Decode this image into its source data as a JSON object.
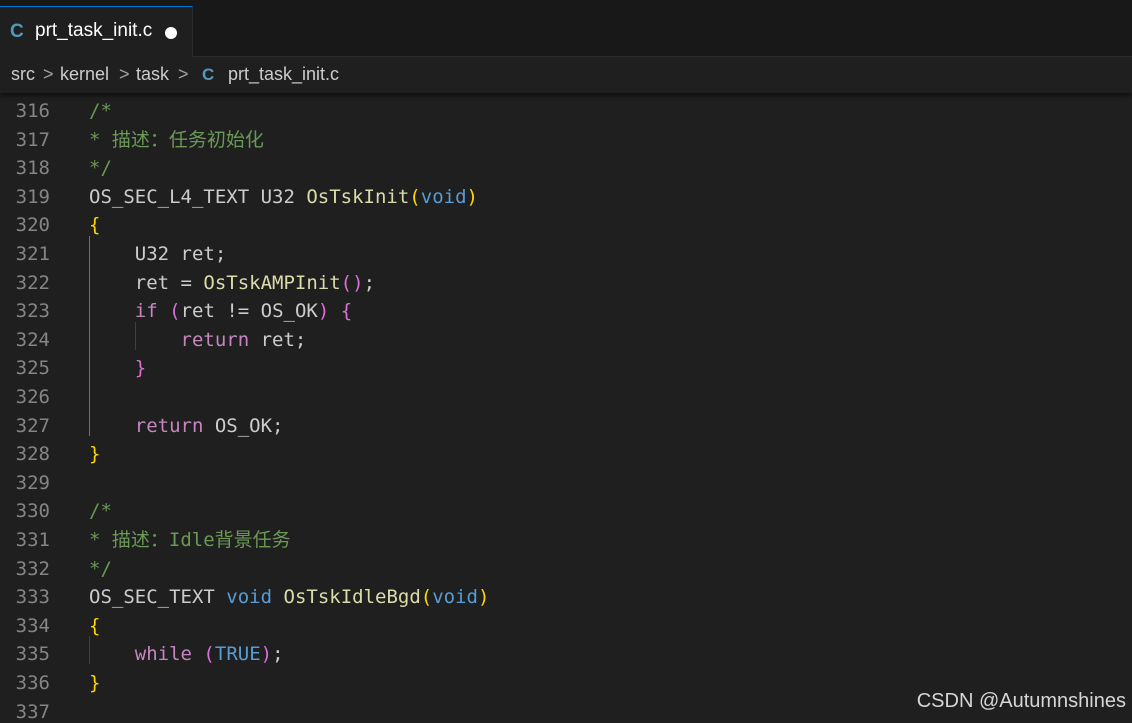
{
  "tab": {
    "file_name": "prt_task_init.c",
    "lang_icon": "C",
    "unsaved_marker": "●"
  },
  "breadcrumb": {
    "items": [
      "src",
      "kernel",
      "task",
      "prt_task_init.c"
    ],
    "separator": ">",
    "file_icon": "C"
  },
  "colors": {
    "keyword_control": "#c586c0",
    "keyword_type": "#569cd6",
    "function": "#dcdcaa",
    "comment": "#6a9955",
    "text": "#cccccc",
    "bracket_level1": "#ffd700",
    "bracket_level2": "#da70d6",
    "bracket_level3": "#179fff",
    "line_number": "#858585",
    "c_icon": "#519aba",
    "tab_active_border": "#0078d4"
  },
  "editor": {
    "lines": [
      {
        "n": "316",
        "tokens": [
          {
            "t": "/*",
            "c": "#6a9955"
          }
        ]
      },
      {
        "n": "317",
        "tokens": [
          {
            "t": "* 描述：任务初始化",
            "c": "#6a9955"
          }
        ]
      },
      {
        "n": "318",
        "tokens": [
          {
            "t": "*/",
            "c": "#6a9955"
          }
        ]
      },
      {
        "n": "319",
        "tokens": [
          {
            "t": "OS_SEC_L4_TEXT U32 ",
            "c": "#cccccc"
          },
          {
            "t": "OsTskInit",
            "c": "#dcdcaa"
          },
          {
            "t": "(",
            "c": "#ffd700"
          },
          {
            "t": "void",
            "c": "#569cd6"
          },
          {
            "t": ")",
            "c": "#ffd700"
          }
        ]
      },
      {
        "n": "320",
        "tokens": [
          {
            "t": "{",
            "c": "#ffd700"
          }
        ]
      },
      {
        "n": "321",
        "tokens": [
          {
            "t": "    U32 ret;",
            "c": "#cccccc"
          }
        ]
      },
      {
        "n": "322",
        "tokens": [
          {
            "t": "    ret = ",
            "c": "#cccccc"
          },
          {
            "t": "OsTskAMPInit",
            "c": "#dcdcaa"
          },
          {
            "t": "()",
            "c": "#da70d6"
          },
          {
            "t": ";",
            "c": "#cccccc"
          }
        ]
      },
      {
        "n": "323",
        "tokens": [
          {
            "t": "    ",
            "c": "#cccccc"
          },
          {
            "t": "if",
            "c": "#c586c0"
          },
          {
            "t": " ",
            "c": "#cccccc"
          },
          {
            "t": "(",
            "c": "#da70d6"
          },
          {
            "t": "ret != OS_OK",
            "c": "#cccccc"
          },
          {
            "t": ")",
            "c": "#da70d6"
          },
          {
            "t": " ",
            "c": "#cccccc"
          },
          {
            "t": "{",
            "c": "#da70d6"
          }
        ]
      },
      {
        "n": "324",
        "tokens": [
          {
            "t": "        ",
            "c": "#cccccc"
          },
          {
            "t": "return",
            "c": "#c586c0"
          },
          {
            "t": " ret;",
            "c": "#cccccc"
          }
        ]
      },
      {
        "n": "325",
        "tokens": [
          {
            "t": "    ",
            "c": "#cccccc"
          },
          {
            "t": "}",
            "c": "#da70d6"
          }
        ]
      },
      {
        "n": "326",
        "tokens": []
      },
      {
        "n": "327",
        "tokens": [
          {
            "t": "    ",
            "c": "#cccccc"
          },
          {
            "t": "return",
            "c": "#c586c0"
          },
          {
            "t": " OS_OK;",
            "c": "#cccccc"
          }
        ]
      },
      {
        "n": "328",
        "tokens": [
          {
            "t": "}",
            "c": "#ffd700"
          }
        ]
      },
      {
        "n": "329",
        "tokens": []
      },
      {
        "n": "330",
        "tokens": [
          {
            "t": "/*",
            "c": "#6a9955"
          }
        ]
      },
      {
        "n": "331",
        "tokens": [
          {
            "t": "* 描述：Idle背景任务",
            "c": "#6a9955"
          }
        ]
      },
      {
        "n": "332",
        "tokens": [
          {
            "t": "*/",
            "c": "#6a9955"
          }
        ]
      },
      {
        "n": "333",
        "tokens": [
          {
            "t": "OS_SEC_TEXT ",
            "c": "#cccccc"
          },
          {
            "t": "void",
            "c": "#569cd6"
          },
          {
            "t": " ",
            "c": "#cccccc"
          },
          {
            "t": "OsTskIdleBgd",
            "c": "#dcdcaa"
          },
          {
            "t": "(",
            "c": "#ffd700"
          },
          {
            "t": "void",
            "c": "#569cd6"
          },
          {
            "t": ")",
            "c": "#ffd700"
          }
        ]
      },
      {
        "n": "334",
        "tokens": [
          {
            "t": "{",
            "c": "#ffd700"
          }
        ]
      },
      {
        "n": "335",
        "tokens": [
          {
            "t": "    ",
            "c": "#cccccc"
          },
          {
            "t": "while",
            "c": "#c586c0"
          },
          {
            "t": " ",
            "c": "#cccccc"
          },
          {
            "t": "(",
            "c": "#da70d6"
          },
          {
            "t": "TRUE",
            "c": "#569cd6"
          },
          {
            "t": ")",
            "c": "#da70d6"
          },
          {
            "t": ";",
            "c": "#cccccc"
          }
        ]
      },
      {
        "n": "336",
        "tokens": [
          {
            "t": "}",
            "c": "#ffd700"
          }
        ]
      },
      {
        "n": "337",
        "tokens": []
      }
    ]
  },
  "watermark": "CSDN @Autumnshines"
}
